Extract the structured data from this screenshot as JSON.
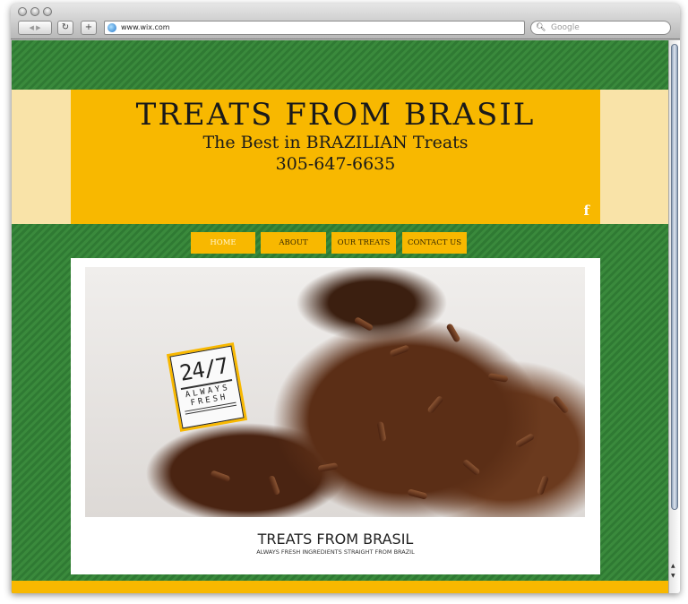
{
  "browser": {
    "url": "www.wix.com",
    "search_placeholder": "Google",
    "back": "◀ ▶",
    "reload": "↻",
    "add": "+"
  },
  "header": {
    "title": "TREATS FROM BRASIL",
    "subtitle": "The Best in BRAZILIAN Treats",
    "phone": "305-647-6635",
    "social": "f"
  },
  "nav": [
    {
      "label": "HOME",
      "active": true
    },
    {
      "label": "ABOUT"
    },
    {
      "label": "OUR TREATS"
    },
    {
      "label": "CONTACT US"
    }
  ],
  "badge": {
    "big": "24/7",
    "line1": "ALWAYS",
    "line2": "FRESH"
  },
  "caption": {
    "title": "TREATS FROM BRASIL",
    "subtitle": "ALWAYS FRESH INGREDIENTS STRAIGHT FROM BRAZIL"
  },
  "colors": {
    "green": "#3a8a3c",
    "yellow": "#f8b800",
    "pale": "#f9e3a8"
  }
}
